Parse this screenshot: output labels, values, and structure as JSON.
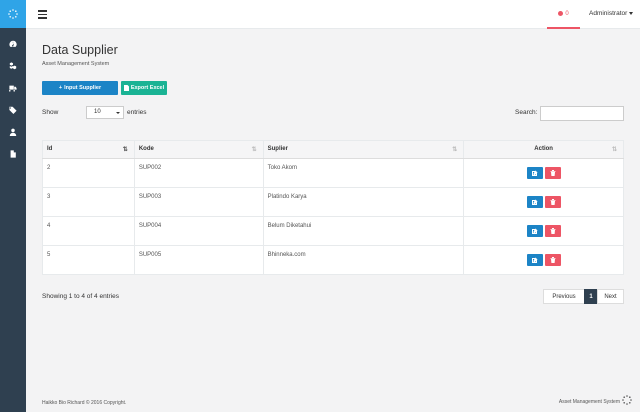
{
  "header": {
    "notif_count": "0",
    "user": "Administrator"
  },
  "page": {
    "title": "Data Supplier",
    "subtitle": "Asset Management System"
  },
  "toolbar": {
    "input_label": "Input Supplier",
    "excel_label": "Export Excel"
  },
  "table_controls": {
    "show_label": "Show",
    "page_size": "10",
    "entries_label": "entries",
    "search_label": "Search:",
    "search_value": ""
  },
  "table": {
    "columns": [
      "Id",
      "Kode",
      "Suplier",
      "Action"
    ],
    "rows": [
      {
        "id": "2",
        "kode": "SUP002",
        "suplier": "Toko Akom"
      },
      {
        "id": "3",
        "kode": "SUP003",
        "suplier": "Platindo Karya"
      },
      {
        "id": "4",
        "kode": "SUP004",
        "suplier": "Belum Diketahui"
      },
      {
        "id": "5",
        "kode": "SUP005",
        "suplier": "Bhinneka.com"
      }
    ]
  },
  "pagination": {
    "info": "Showing 1 to 4 of 4 entries",
    "prev": "Previous",
    "current": "1",
    "next": "Next"
  },
  "footer": {
    "copyright": "Haikko Bio Richard © 2016 Copyright.",
    "app_name": "Asset Management System"
  },
  "colors": {
    "sidebar": "#2f4050",
    "primary": "#1c84c6",
    "success": "#1ab394",
    "danger": "#ed5565",
    "logo_bg": "#2fa4e7"
  },
  "icons": {
    "sidebar": [
      "dashboard-icon",
      "cubes-icon",
      "truck-icon",
      "tags-icon",
      "user-icon",
      "file-icon"
    ],
    "edit": "edit-icon",
    "delete": "trash-icon"
  }
}
